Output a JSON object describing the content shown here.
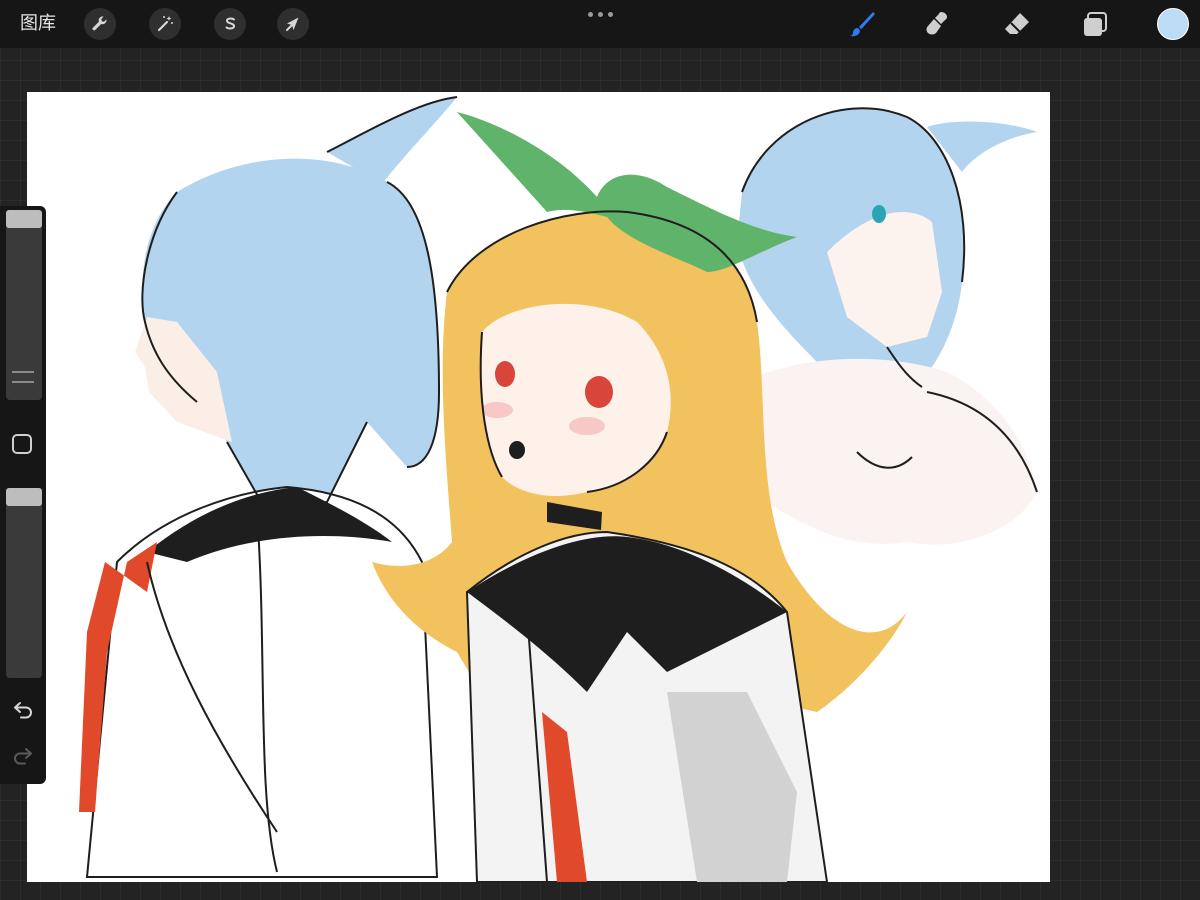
{
  "topbar": {
    "gallery_label": "图库",
    "left_tools": [
      {
        "icon": "wrench-icon",
        "name": "actions-button"
      },
      {
        "icon": "magic-wand-icon",
        "name": "adjustments-button"
      },
      {
        "icon": "selection-s-icon",
        "name": "selection-button"
      },
      {
        "icon": "arrow-cursor-icon",
        "name": "transform-button"
      }
    ],
    "right_tools": [
      {
        "icon": "brush-icon",
        "name": "brush-tool-button",
        "active": true
      },
      {
        "icon": "smudge-icon",
        "name": "smudge-tool-button"
      },
      {
        "icon": "eraser-icon",
        "name": "eraser-tool-button"
      },
      {
        "icon": "layers-icon",
        "name": "layers-button"
      }
    ],
    "active_tool_color": "#2c7cf0",
    "current_color": "#bcdcf6"
  },
  "sidebar": {
    "brush_size": 0.0,
    "brush_opacity": 0.0,
    "icons": [
      "modify-square-icon",
      "undo-icon",
      "redo-icon"
    ]
  },
  "artwork": {
    "colors": {
      "hair_blue": "#b3d4ef",
      "hair_blonde": "#f2c25e",
      "ribbon_green": "#5fb36a",
      "ribbon_red": "#e04a2a",
      "lineart": "#1e1e1e",
      "shadow_gray": "#d2d2d2",
      "eye_red": "#d8453a",
      "eye_teal": "#2aa5b5",
      "blush": "#f4b6b6"
    }
  }
}
